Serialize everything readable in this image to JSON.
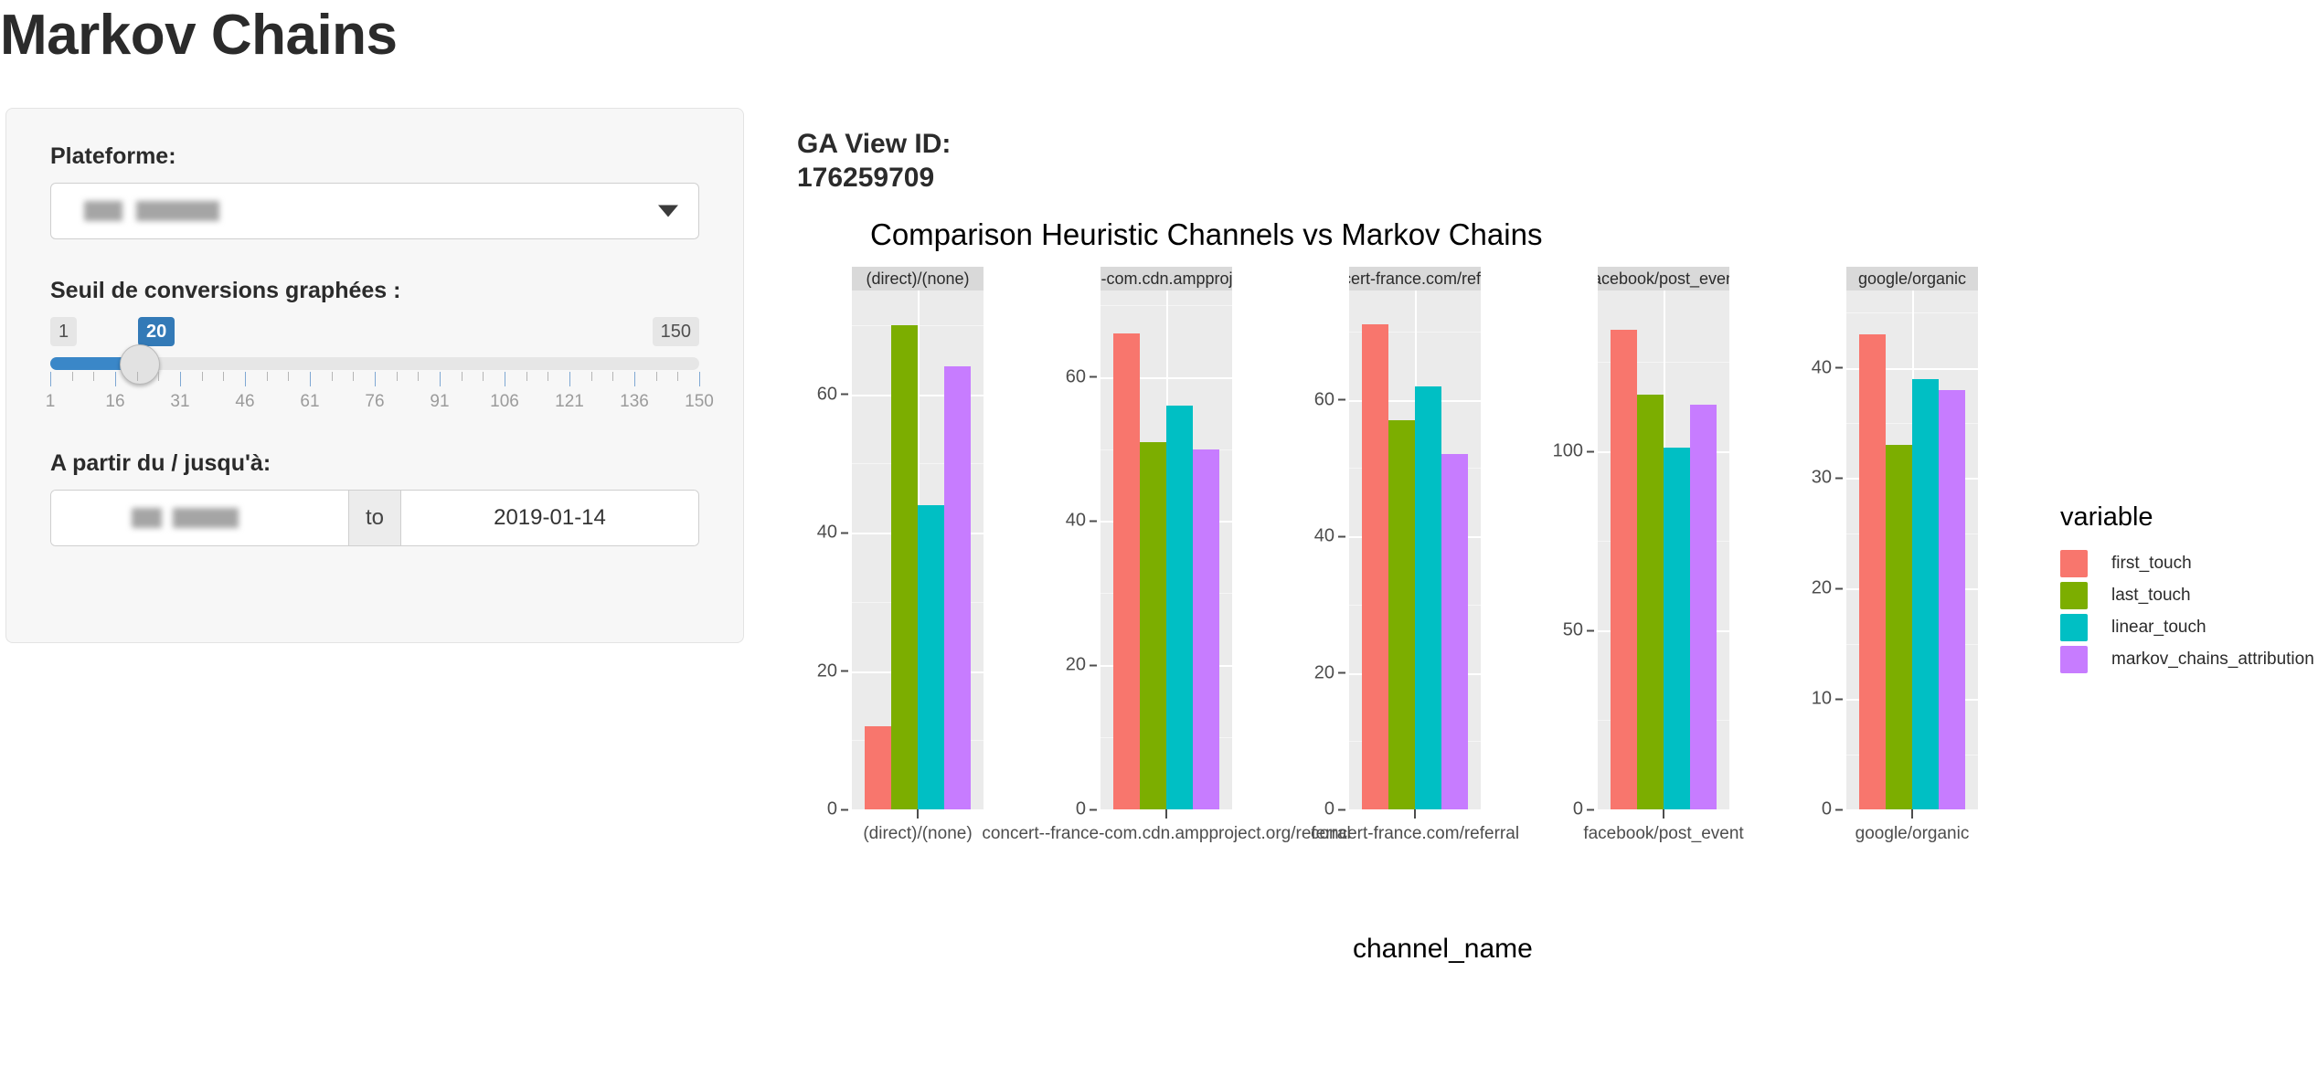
{
  "page_title": "Markov Chains",
  "sidebar": {
    "platform_label": "Plateforme:",
    "platform_value": "",
    "threshold_label": "Seuil de conversions graphées :",
    "slider": {
      "min_label": "1",
      "max_label": "150",
      "current_label": "20",
      "tick_labels": [
        "1",
        "16",
        "31",
        "46",
        "61",
        "76",
        "91",
        "106",
        "121",
        "136",
        "150"
      ]
    },
    "date_label": "A partir du / jusqu'à:",
    "date_from": "",
    "date_sep": "to",
    "date_to": "2019-01-14"
  },
  "header": {
    "ga_view_id_label": "GA View ID:",
    "ga_view_id_value": "176259709"
  },
  "chart_data": {
    "type": "bar",
    "title": "Comparison Heuristic Channels vs Markov Chains",
    "xlabel": "channel_name",
    "ylabel": "",
    "grid": true,
    "legend_position": "right",
    "legend_title": "variable",
    "series": [
      {
        "name": "first_touch",
        "color": "#F8766D"
      },
      {
        "name": "last_touch",
        "color": "#7CAE00"
      },
      {
        "name": "linear_touch",
        "color": "#00BFC4"
      },
      {
        "name": "markov_chains_attribution",
        "color": "#C77CFF"
      }
    ],
    "facet_var": "channel_name",
    "facets": [
      {
        "strip": "(direct)/(none)",
        "x_label": "(direct)/(none)",
        "ticks": [
          0,
          20,
          40,
          60
        ],
        "ymax": 75,
        "values": [
          12,
          70,
          44,
          64
        ]
      },
      {
        "strip": "ance-com.cdn.ampproject.c",
        "x_label": "concert--france-com.cdn.ampproject.org/referral",
        "ticks": [
          0,
          20,
          40,
          60
        ],
        "ymax": 72,
        "values": [
          66,
          51,
          56,
          50
        ]
      },
      {
        "strip": "concert-france.com/referral",
        "x_label": "concert-france.com/referral",
        "ticks": [
          0,
          20,
          40,
          60
        ],
        "ymax": 76,
        "values": [
          71,
          57,
          62,
          52
        ]
      },
      {
        "strip": "facebook/post_event",
        "x_label": "facebook/post_event",
        "ticks": [
          0,
          50,
          100
        ],
        "ymax": 145,
        "values": [
          134,
          116,
          101,
          113
        ]
      },
      {
        "strip": "google/organic",
        "x_label": "google/organic",
        "ticks": [
          0,
          10,
          20,
          30,
          40
        ],
        "ymax": 47,
        "values": [
          43,
          33,
          39,
          38
        ]
      }
    ]
  }
}
